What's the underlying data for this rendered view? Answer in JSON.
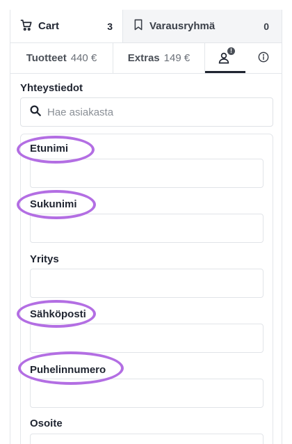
{
  "top_tabs": {
    "cart": {
      "label": "Cart",
      "count": "3",
      "icon": "cart-icon"
    },
    "group": {
      "label": "Varausryhmä",
      "count": "0",
      "icon": "bookmark-icon"
    }
  },
  "sub_tabs": {
    "products": {
      "label": "Tuotteet",
      "price": "440 €"
    },
    "extras": {
      "label": "Extras",
      "price": "149 €"
    },
    "contact": {
      "icon": "person-icon",
      "badge": "!"
    },
    "info": {
      "icon": "info-icon"
    }
  },
  "contact": {
    "section_title": "Yhteystiedot",
    "search_placeholder": "Hae asiakasta",
    "fields": {
      "first_name": "Etunimi",
      "last_name": "Sukunimi",
      "company": "Yritys",
      "email": "Sähköposti",
      "phone": "Puhelinnumero",
      "address": "Osoite"
    }
  },
  "colors": {
    "highlight": "#b36ee3",
    "active_underline": "#1f2430",
    "border": "#e3e6ea"
  }
}
